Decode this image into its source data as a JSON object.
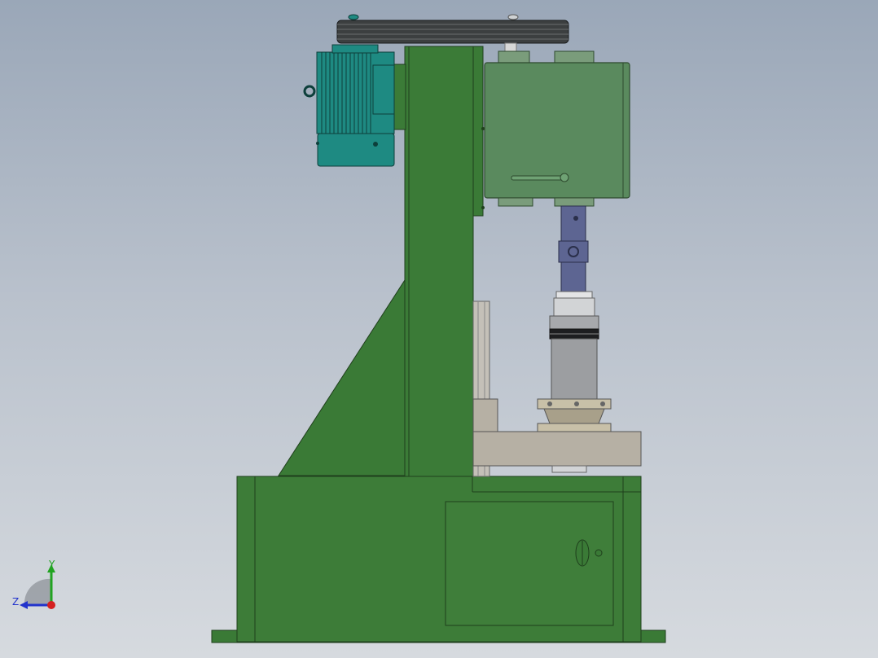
{
  "viewport": {
    "kind": "cad-3d-view",
    "background_top": "#9aa7b8",
    "background_bottom": "#d6dadf"
  },
  "model": {
    "frame_color": "#3a7a36",
    "frame_edge": "#1f3f1c",
    "gearbox_color": "#5a8a5e",
    "motor_color": "#1e8a82",
    "shaft_color": "#5d6592",
    "cylinder_color": "#9c9ea1",
    "bracket_color": "#b6b0a4",
    "belt_color": "#3c3f40"
  },
  "triad": {
    "y_label": "Y",
    "z_label": "Z",
    "y_color": "#21a321",
    "z_color": "#2233cc",
    "x_color": "#d42020"
  }
}
